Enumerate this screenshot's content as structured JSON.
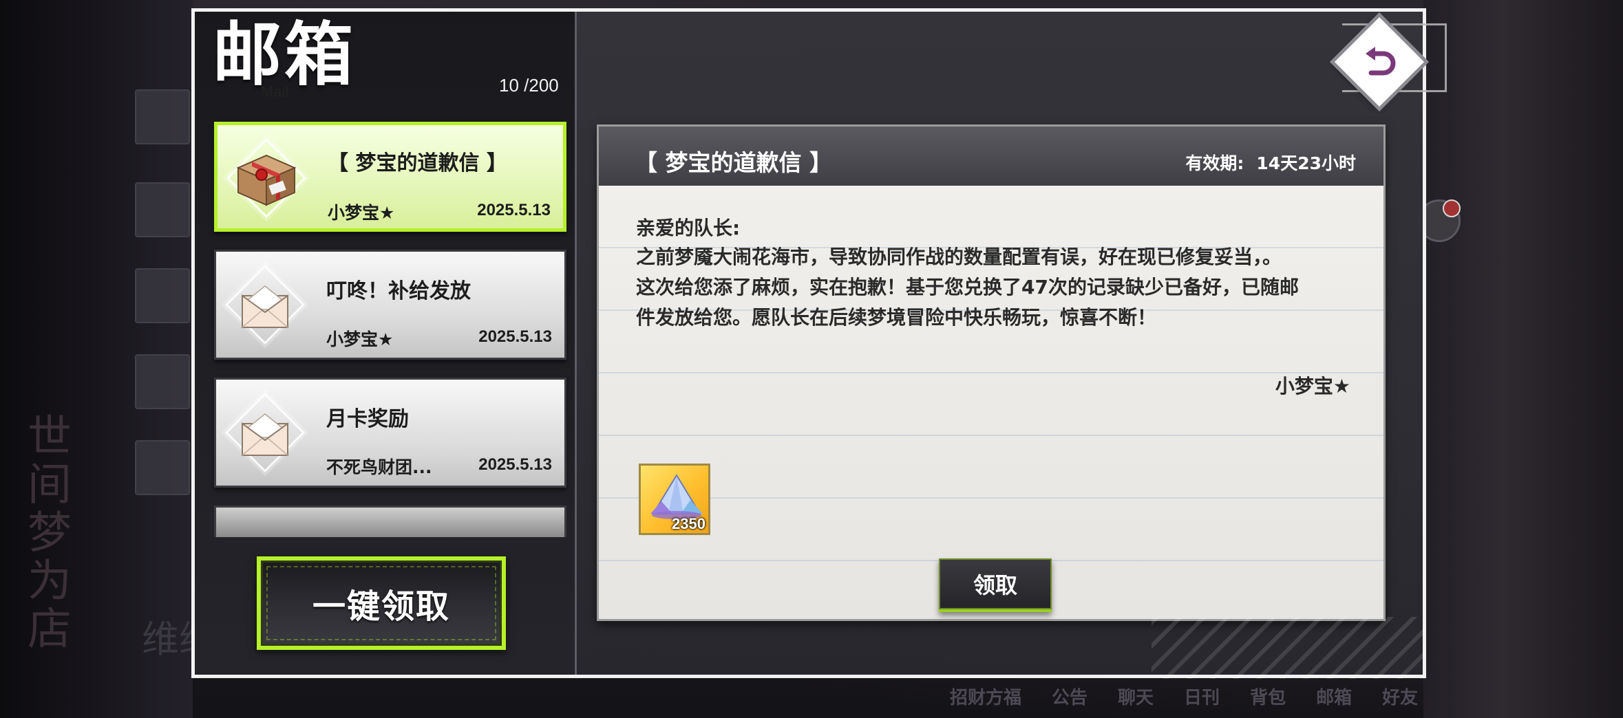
{
  "mailbox": {
    "title": "邮箱",
    "subtitle": "Mail",
    "count": "10 /200",
    "claim_all_label": "一键领取"
  },
  "mails": [
    {
      "title": "【 梦宝的道歉信 】",
      "sender": "小梦宝★",
      "date": "2025.5.13",
      "icon": "gift-box-icon",
      "selected": true
    },
    {
      "title": "叮咚！补给发放",
      "sender": "小梦宝★",
      "date": "2025.5.13",
      "icon": "envelope-icon",
      "selected": false
    },
    {
      "title": "月卡奖励",
      "sender": "不死鸟财团...",
      "date": "2025.5.13",
      "icon": "envelope-icon",
      "selected": false
    }
  ],
  "detail": {
    "title": "【 梦宝的道歉信 】",
    "validity_label": "有效期:",
    "validity_value": "14天23小时",
    "greeting": "亲爱的队长:",
    "body_lines": [
      "之前梦魇大闹花海市，导致协同作战的数量配置有误，好在现已修复妥当，。",
      "这次给您添了麻烦，实在抱歉！基于您兑换了47次的记录缺少已备好，已随邮",
      "件发放给您。愿队长在后续梦境冒险中快乐畅玩，惊喜不断！"
    ],
    "signature": "小梦宝★",
    "reward": {
      "icon": "crystal-pile-icon",
      "quantity": "2350"
    },
    "claim_label": "领取"
  },
  "background": {
    "bottom_nav": [
      "招财方福",
      "公告",
      "聊天",
      "日刊",
      "背包",
      "邮箱",
      "好友"
    ],
    "side_text": "世间梦为店",
    "bottom_left_title": "维纳陷阱"
  },
  "colors": {
    "accent_green": "#b6f02a",
    "panel_border": "#f2f2f2",
    "back_icon": "#7a3a7a"
  }
}
